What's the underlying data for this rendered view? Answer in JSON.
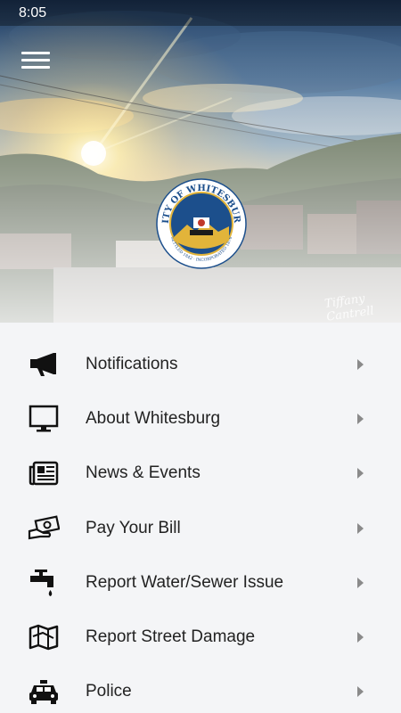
{
  "status_bar": {
    "time": "8:05"
  },
  "header": {
    "seal_text_top": "CITY OF WHITESBURG",
    "seal_text_bottom": "SETTLED 1842 · INCORPORATED 1876",
    "signature": "Tiffany Cantrell"
  },
  "menu": {
    "items": [
      {
        "label": "Notifications",
        "icon": "megaphone-icon"
      },
      {
        "label": "About Whitesburg",
        "icon": "monitor-icon"
      },
      {
        "label": "News & Events",
        "icon": "newspaper-icon"
      },
      {
        "label": "Pay Your Bill",
        "icon": "money-hand-icon"
      },
      {
        "label": "Report Water/Sewer Issue",
        "icon": "water-faucet-icon"
      },
      {
        "label": "Report Street Damage",
        "icon": "map-icon"
      },
      {
        "label": "Police",
        "icon": "police-car-icon"
      }
    ]
  },
  "colors": {
    "background": "#f4f5f7",
    "text": "#222222",
    "chevron": "#8a8a8a",
    "seal_blue": "#1c4f8c",
    "seal_gold": "#e2b43a"
  }
}
